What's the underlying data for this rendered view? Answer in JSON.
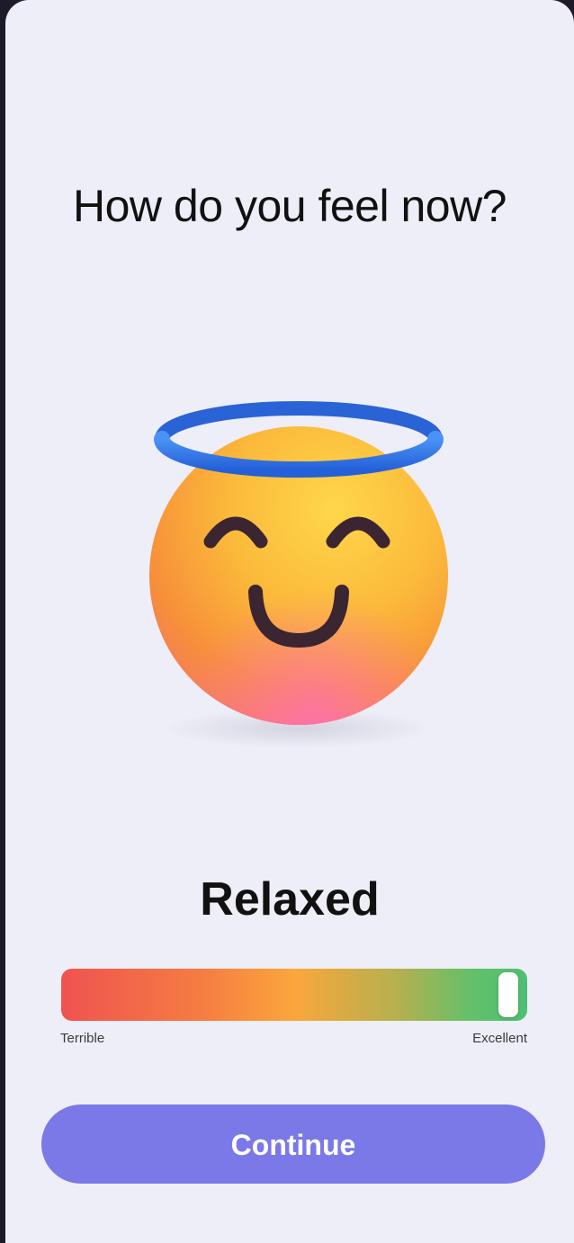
{
  "screen": {
    "question": "How do you feel now?",
    "emoji_icon": "smiling-face-with-halo-icon",
    "mood_label": "Relaxed"
  },
  "mood_slider": {
    "min_label": "Terrible",
    "max_label": "Excellent",
    "value": 1.0,
    "gradient_colors": [
      "#ef5350",
      "#f57c42",
      "#fba63c",
      "#b5b04f",
      "#64c06a",
      "#4cbf74"
    ]
  },
  "continue_button": {
    "label": "Continue",
    "color": "#7b79e8"
  }
}
